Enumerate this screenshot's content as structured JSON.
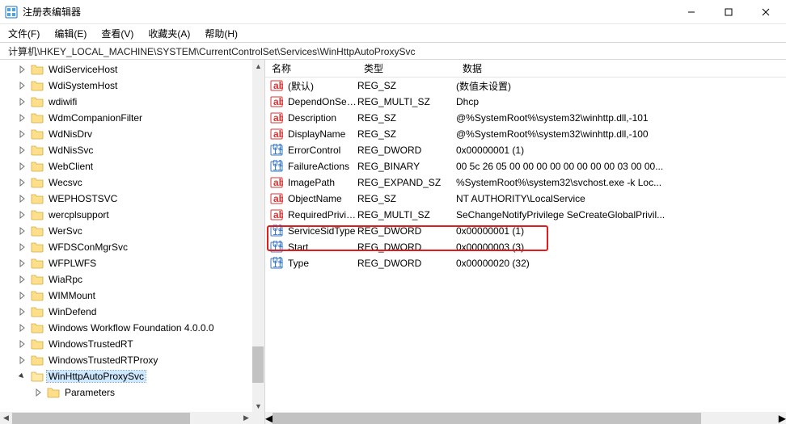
{
  "window": {
    "title": "注册表编辑器"
  },
  "menu": {
    "file": "文件(F)",
    "edit": "编辑(E)",
    "view": "查看(V)",
    "fav": "收藏夹(A)",
    "help": "帮助(H)"
  },
  "address": "计算机\\HKEY_LOCAL_MACHINE\\SYSTEM\\CurrentControlSet\\Services\\WinHttpAutoProxySvc",
  "tree": [
    {
      "label": "WdiServiceHost",
      "expand": "closed"
    },
    {
      "label": "WdiSystemHost",
      "expand": "closed"
    },
    {
      "label": "wdiwifi",
      "expand": "closed"
    },
    {
      "label": "WdmCompanionFilter",
      "expand": "closed"
    },
    {
      "label": "WdNisDrv",
      "expand": "closed"
    },
    {
      "label": "WdNisSvc",
      "expand": "closed"
    },
    {
      "label": "WebClient",
      "expand": "closed"
    },
    {
      "label": "Wecsvc",
      "expand": "closed"
    },
    {
      "label": "WEPHOSTSVC",
      "expand": "closed"
    },
    {
      "label": "wercplsupport",
      "expand": "closed"
    },
    {
      "label": "WerSvc",
      "expand": "closed"
    },
    {
      "label": "WFDSConMgrSvc",
      "expand": "closed"
    },
    {
      "label": "WFPLWFS",
      "expand": "closed"
    },
    {
      "label": "WiaRpc",
      "expand": "closed"
    },
    {
      "label": "WIMMount",
      "expand": "closed"
    },
    {
      "label": "WinDefend",
      "expand": "closed"
    },
    {
      "label": "Windows Workflow Foundation 4.0.0.0",
      "expand": "closed"
    },
    {
      "label": "WindowsTrustedRT",
      "expand": "closed"
    },
    {
      "label": "WindowsTrustedRTProxy",
      "expand": "closed"
    },
    {
      "label": "WinHttpAutoProxySvc",
      "expand": "open",
      "selected": true
    }
  ],
  "tree_child": {
    "label": "Parameters",
    "expand": "closed"
  },
  "columns": {
    "name": "名称",
    "type": "类型",
    "data": "数据"
  },
  "values": [
    {
      "icon": "sz",
      "name": "(默认)",
      "type": "REG_SZ",
      "data": "(数值未设置)"
    },
    {
      "icon": "sz",
      "name": "DependOnSer...",
      "type": "REG_MULTI_SZ",
      "data": "Dhcp"
    },
    {
      "icon": "sz",
      "name": "Description",
      "type": "REG_SZ",
      "data": "@%SystemRoot%\\system32\\winhttp.dll,-101"
    },
    {
      "icon": "sz",
      "name": "DisplayName",
      "type": "REG_SZ",
      "data": "@%SystemRoot%\\system32\\winhttp.dll,-100"
    },
    {
      "icon": "bin",
      "name": "ErrorControl",
      "type": "REG_DWORD",
      "data": "0x00000001 (1)"
    },
    {
      "icon": "bin",
      "name": "FailureActions",
      "type": "REG_BINARY",
      "data": "00 5c 26 05 00 00 00 00 00 00 00 00 03 00 00..."
    },
    {
      "icon": "sz",
      "name": "ImagePath",
      "type": "REG_EXPAND_SZ",
      "data": "%SystemRoot%\\system32\\svchost.exe -k Loc..."
    },
    {
      "icon": "sz",
      "name": "ObjectName",
      "type": "REG_SZ",
      "data": "NT AUTHORITY\\LocalService"
    },
    {
      "icon": "sz",
      "name": "RequiredPrivile...",
      "type": "REG_MULTI_SZ",
      "data": "SeChangeNotifyPrivilege SeCreateGlobalPrivil..."
    },
    {
      "icon": "bin",
      "name": "ServiceSidType",
      "type": "REG_DWORD",
      "data": "0x00000001 (1)"
    },
    {
      "icon": "bin",
      "name": "Start",
      "type": "REG_DWORD",
      "data": "0x00000003 (3)"
    },
    {
      "icon": "bin",
      "name": "Type",
      "type": "REG_DWORD",
      "data": "0x00000020 (32)"
    }
  ],
  "highlight_index": 10
}
